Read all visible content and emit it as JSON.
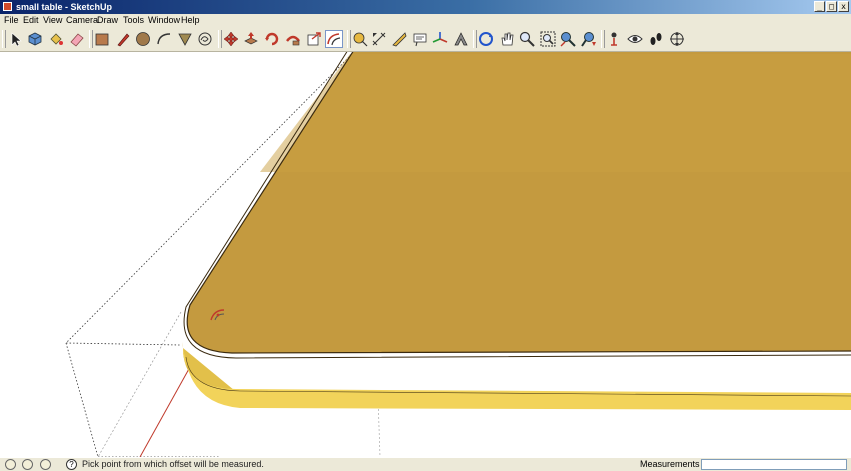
{
  "window": {
    "title": "small table - SketchUp",
    "minimize_glyph": "_",
    "maximize_glyph": "□",
    "close_glyph": "x"
  },
  "menu": [
    "File",
    "Edit",
    "View",
    "Camera",
    "Draw",
    "Tools",
    "Window",
    "Help"
  ],
  "toolbar": {
    "tools": [
      {
        "name": "select-tool",
        "icon": "arrow-icon"
      },
      {
        "name": "make-component-tool",
        "icon": "component-icon"
      },
      {
        "name": "paint-bucket-tool",
        "icon": "paint-bucket-icon"
      },
      {
        "name": "eraser-tool",
        "icon": "eraser-icon"
      },
      {
        "name": "rectangle-tool",
        "icon": "rectangle-icon"
      },
      {
        "name": "line-tool",
        "icon": "pencil-icon"
      },
      {
        "name": "circle-tool",
        "icon": "circle-icon"
      },
      {
        "name": "arc-tool",
        "icon": "arc-icon"
      },
      {
        "name": "polygon-tool",
        "icon": "polygon-icon"
      },
      {
        "name": "freehand-tool",
        "icon": "freehand-icon"
      },
      {
        "name": "move-tool",
        "icon": "move-icon"
      },
      {
        "name": "push-pull-tool",
        "icon": "push-pull-icon"
      },
      {
        "name": "rotate-tool",
        "icon": "rotate-icon"
      },
      {
        "name": "follow-me-tool",
        "icon": "follow-me-icon"
      },
      {
        "name": "scale-tool",
        "icon": "scale-icon"
      },
      {
        "name": "offset-tool",
        "icon": "offset-icon",
        "active": true
      },
      {
        "name": "tape-measure-tool",
        "icon": "tape-measure-icon"
      },
      {
        "name": "dimension-tool",
        "icon": "dimension-icon"
      },
      {
        "name": "protractor-tool",
        "icon": "protractor-icon"
      },
      {
        "name": "text-tool",
        "icon": "text-label-icon"
      },
      {
        "name": "axes-tool",
        "icon": "axes-icon"
      },
      {
        "name": "3d-text-tool",
        "icon": "3d-text-icon"
      },
      {
        "name": "orbit-tool",
        "icon": "orbit-icon"
      },
      {
        "name": "pan-tool",
        "icon": "hand-icon"
      },
      {
        "name": "zoom-tool",
        "icon": "magnifier-icon"
      },
      {
        "name": "zoom-window-tool",
        "icon": "zoom-window-icon"
      },
      {
        "name": "zoom-extents-tool",
        "icon": "zoom-extents-icon"
      },
      {
        "name": "previous-view-tool",
        "icon": "previous-view-icon"
      },
      {
        "name": "position-camera-tool",
        "icon": "position-camera-icon"
      },
      {
        "name": "look-around-tool",
        "icon": "eye-icon"
      },
      {
        "name": "walk-tool",
        "icon": "footprints-icon"
      },
      {
        "name": "section-plane-tool",
        "icon": "section-plane-icon"
      }
    ],
    "offset_tool_color": "#c0392b"
  },
  "viewport": {
    "background": "#ffffff",
    "tabletop_color": "#c49a3f",
    "edge_face_color": "#f2d35a",
    "edge_shadow_color": "#d6b23c",
    "outline_color": "#3a2a10",
    "axis_red_color": "#c0392b"
  },
  "statusbar": {
    "help_glyph": "?",
    "message": "Pick point from which offset will be measured.",
    "measurements_label": "Measurements",
    "measurements_value": ""
  }
}
